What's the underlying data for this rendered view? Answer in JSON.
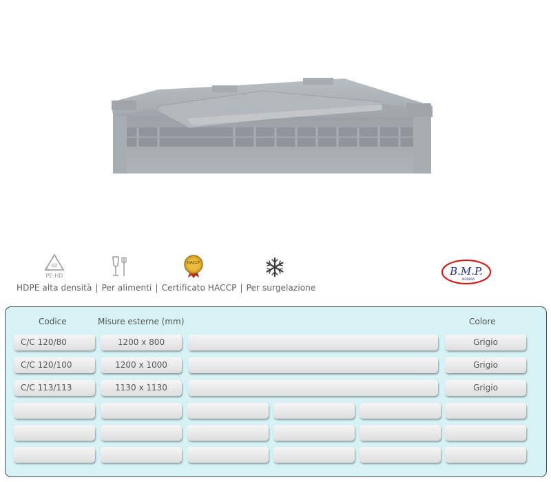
{
  "icons": {
    "recycle": "recycle-pe-hd-icon",
    "recycle_code": "02",
    "recycle_material": "PE-HD",
    "food": "food-safe-icon",
    "haccp": "haccp-seal-icon",
    "haccp_text": "HACCP",
    "snow": "snowflake-icon"
  },
  "features": [
    "HDPE alta densità",
    "Per alimenti",
    "Certificato HACCP",
    "Per surgelazione"
  ],
  "separator": "|",
  "logo": {
    "text": "B.M.P.",
    "sub": "MODENA",
    "color": "#d01e1e"
  },
  "table": {
    "headers": {
      "code": "Codice",
      "size": "Misure esterne (mm)",
      "color": "Colore"
    },
    "rows": [
      {
        "code": "C/C 120/80",
        "size": "1200 x 800",
        "color": "Grigio"
      },
      {
        "code": "C/C 120/100",
        "size": "1200 x 1000",
        "color": "Grigio"
      },
      {
        "code": "C/C 113/113",
        "size": "1130 x 1130",
        "color": "Grigio"
      }
    ],
    "empty_rows": 3,
    "panel_color": "#d6f2f5"
  }
}
